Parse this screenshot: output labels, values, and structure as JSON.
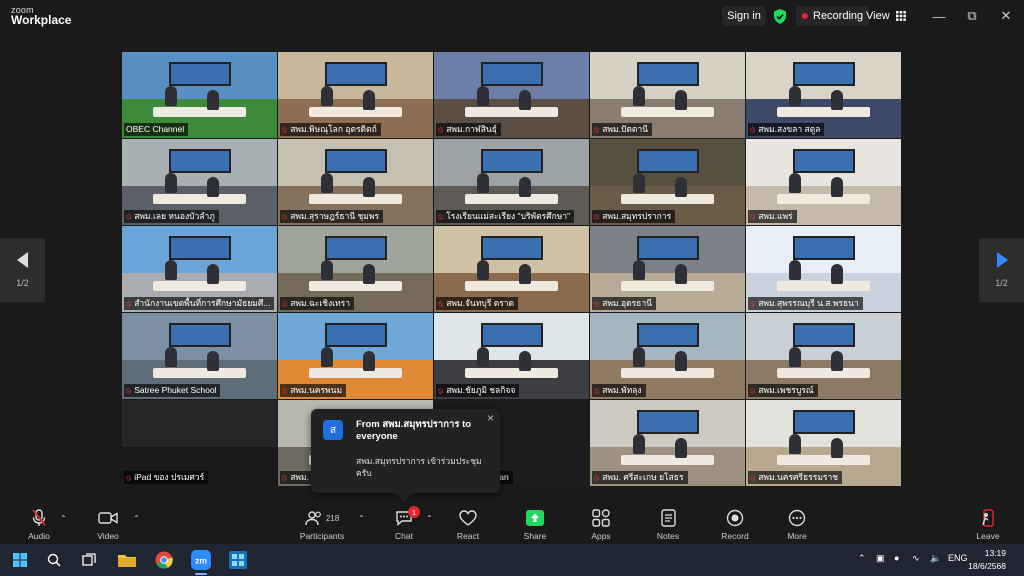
{
  "window": {
    "brand_line1": "zoom",
    "brand_line2": "Workplace",
    "signin": "Sign in",
    "recording": "Recording",
    "view": "View"
  },
  "pager": {
    "left": "1/2",
    "right": "1/2"
  },
  "tiles": [
    {
      "name": "OBEC Channel",
      "mic_muted": false,
      "active": true
    },
    {
      "name": "สพม.พิษณุโลก อุตรดิตถ์",
      "mic_muted": true
    },
    {
      "name": "สพม.กาฬสินธุ์",
      "mic_muted": true
    },
    {
      "name": "สพม.ปัตตานี",
      "mic_muted": true
    },
    {
      "name": "สพม.สงขลา สตูล",
      "mic_muted": true
    },
    {
      "name": "สพม.เลย หนองบัวลำภู",
      "mic_muted": true
    },
    {
      "name": "สพม.สุราษฎร์ธานี ชุมพร",
      "mic_muted": true
    },
    {
      "name": "โรงเรียนแม่สะเรียง \"บริพัตรศึกษา\"",
      "mic_muted": true
    },
    {
      "name": "สพม.สมุทรปราการ",
      "mic_muted": true
    },
    {
      "name": "สพม.แพร่",
      "mic_muted": true
    },
    {
      "name": "สำนักงานเขตพื้นที่การศึกษามัธยมศึ...",
      "mic_muted": true
    },
    {
      "name": "สพม.ฉะเชิงเทรา",
      "mic_muted": true
    },
    {
      "name": "สพม.จันทบุรี ตราด",
      "mic_muted": true
    },
    {
      "name": "สพม.อุดรธานี",
      "mic_muted": true
    },
    {
      "name": "สพม.สุพรรณบุรี น.ส.พรธนา",
      "mic_muted": true
    },
    {
      "name": "Satree Phuket School",
      "mic_muted": true
    },
    {
      "name": "สพม.นครพนม",
      "mic_muted": true
    },
    {
      "name": "สพม.ชัยภูมิ ชลกิจจ",
      "mic_muted": true
    },
    {
      "name": "สพม.พัทลุง",
      "mic_muted": true
    },
    {
      "name": "สพม.เพชรบูรณ์",
      "mic_muted": true
    },
    {
      "name": "iPad ของ ปรเมศวร์",
      "mic_muted": true
    },
    {
      "name": "สพม.",
      "mic_muted": true
    },
    {
      "name": "นี ชัยนาท Lawan",
      "mic_muted": true
    },
    {
      "name": "สพม. ศรีสะเกษ ยโสธร",
      "mic_muted": true
    },
    {
      "name": "สพม.นครศรีธรรมราช",
      "mic_muted": true
    }
  ],
  "toast": {
    "avatar": "ส",
    "title": "From สพม.สมุทรปราการ to everyone",
    "message": "สพม.สมุทรปราการ เข้าร่วมประชุม ครับ"
  },
  "controls": {
    "audio": "Audio",
    "video": "Video",
    "participants": "Participants",
    "participants_count": "218",
    "chat": "Chat",
    "chat_badge": "1",
    "react": "React",
    "share": "Share",
    "apps": "Apps",
    "notes": "Notes",
    "record": "Record",
    "more": "More",
    "leave": "Leave"
  },
  "taskbar": {
    "lang": "ENG",
    "time": "13:19",
    "date": "18/6/2568"
  },
  "colors": {
    "active_speaker": "#23d962",
    "share": "#23d962",
    "leave": "#e02828",
    "badge": "#e02828"
  }
}
